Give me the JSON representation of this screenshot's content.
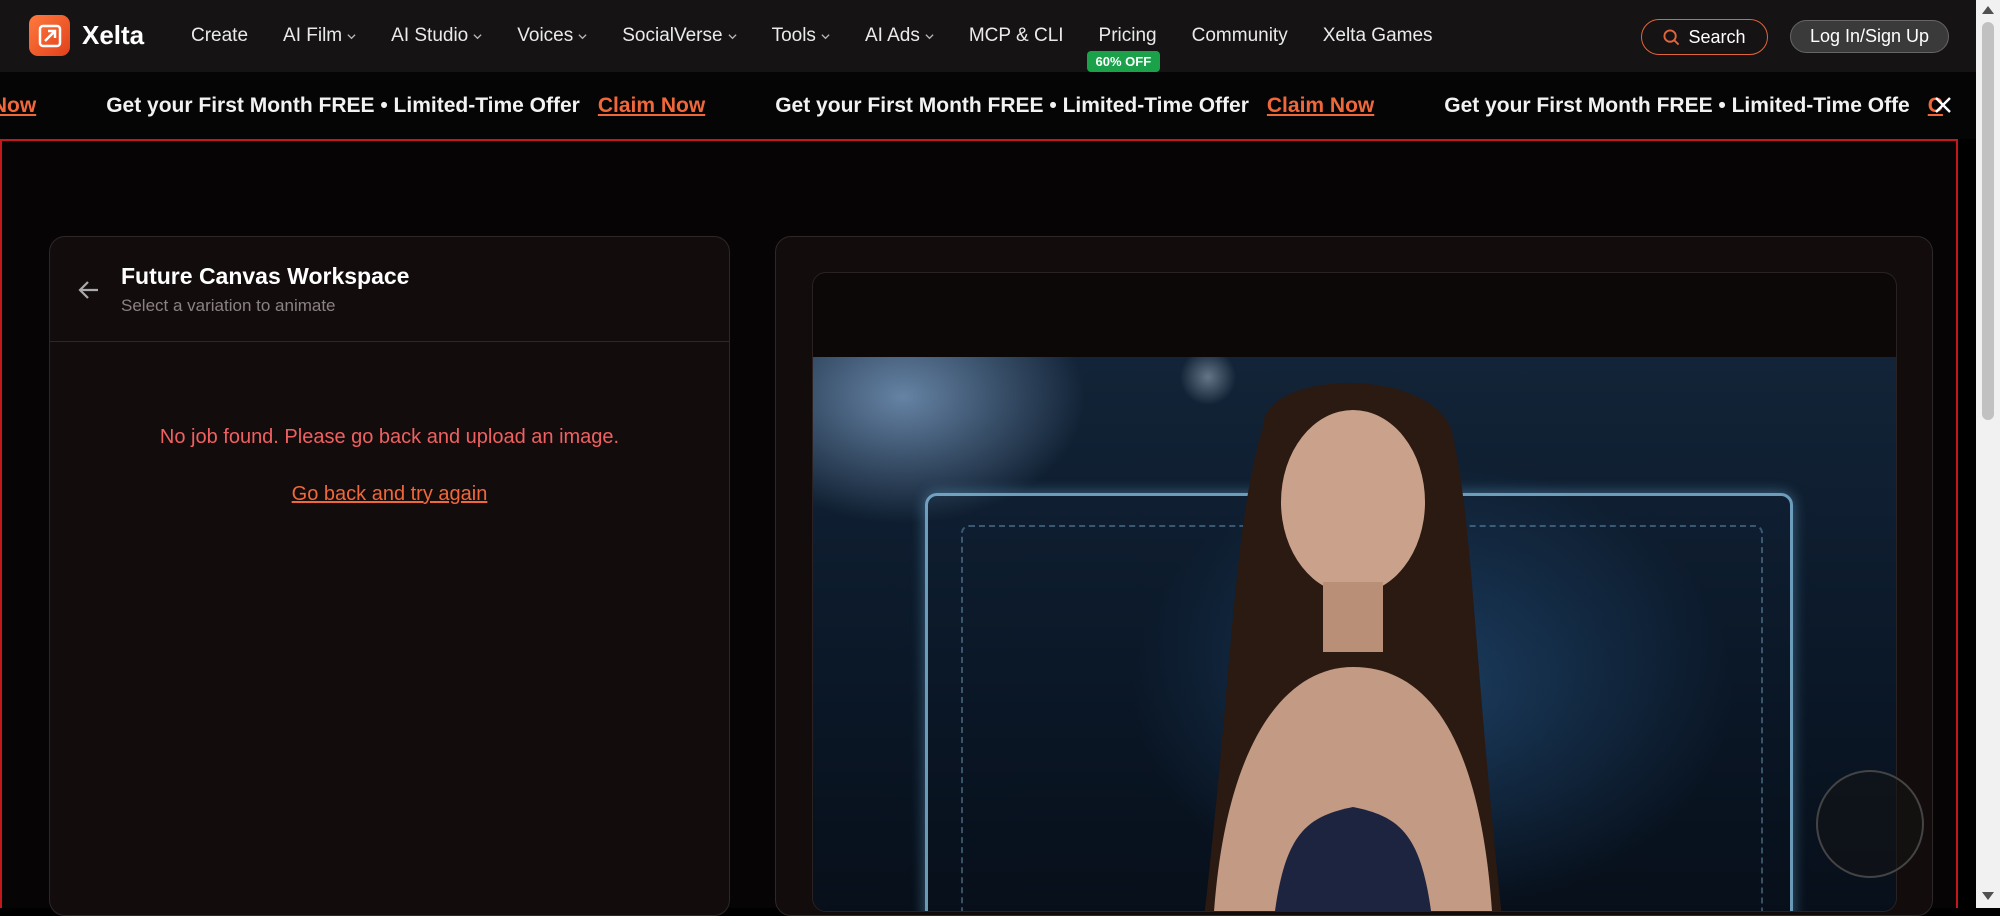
{
  "brand": {
    "name": "Xelta"
  },
  "nav": {
    "items": [
      {
        "label": "Create",
        "dropdown": false
      },
      {
        "label": "AI Film",
        "dropdown": true
      },
      {
        "label": "AI Studio",
        "dropdown": true
      },
      {
        "label": "Voices",
        "dropdown": true
      },
      {
        "label": "SocialVerse",
        "dropdown": true
      },
      {
        "label": "Tools",
        "dropdown": true
      },
      {
        "label": "AI Ads",
        "dropdown": true
      },
      {
        "label": "MCP & CLI",
        "dropdown": false
      },
      {
        "label": "Pricing",
        "dropdown": false
      },
      {
        "label": "Community",
        "dropdown": false
      },
      {
        "label": "Xelta Games",
        "dropdown": false
      }
    ],
    "pricing_badge": "60% OFF",
    "search_label": "Search",
    "login_label": "Log In/Sign Up"
  },
  "promo": {
    "leading_link": "laim Now",
    "text": "Get your First Month FREE • Limited-Time Offer",
    "link": "Claim Now",
    "trailing_text": "Get your First Month FREE • Limited-Time Offe",
    "trailing_link": "C"
  },
  "workspace": {
    "title": "Future Canvas Workspace",
    "subtitle": "Select a variation to animate",
    "error": "No job found. Please go back and upload an image.",
    "retry_link": "Go back and try again"
  },
  "colors": {
    "accent": "#f0683a",
    "error": "#f06060",
    "badge": "#1aa14a",
    "frame": "#c3191c"
  }
}
